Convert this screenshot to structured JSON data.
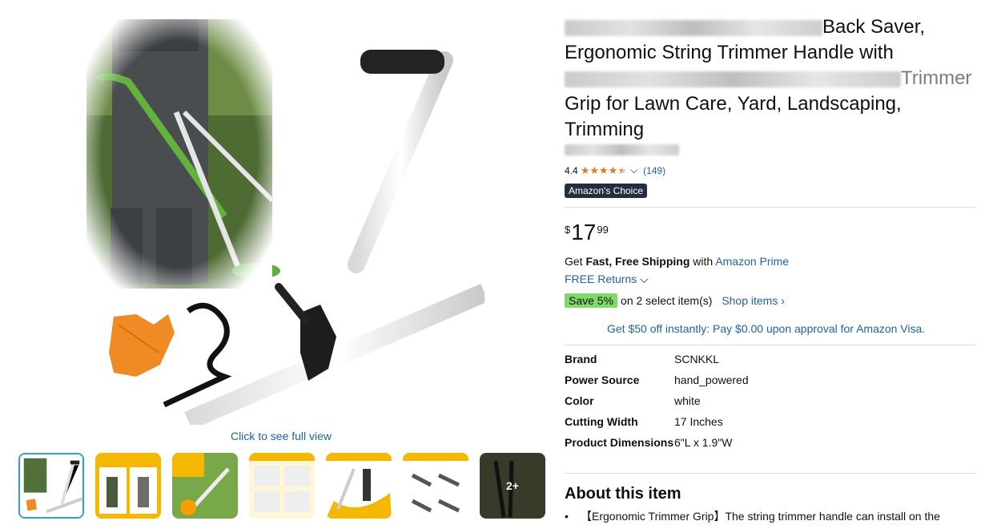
{
  "product": {
    "title_line1": "Back Saver,",
    "title_line2": "Ergonomic String Trimmer Handle with",
    "title_line3_suffix": "Trimmer",
    "title_line4": "Grip for Lawn Care, Yard, Landscaping,",
    "title_line5": "Trimming"
  },
  "gallery": {
    "click_full_view": "Click to see full view",
    "more_label": "2+"
  },
  "rating": {
    "value": "4.4",
    "stars": 4.4,
    "count": "(149)"
  },
  "badge": {
    "choice": "Amazon's Choice"
  },
  "price": {
    "symbol": "$",
    "whole": "17",
    "fraction": "99"
  },
  "shipping": {
    "prefix": "Get ",
    "bold": "Fast, Free Shipping",
    "middle": " with ",
    "prime": "Amazon Prime"
  },
  "returns": {
    "label": "FREE Returns"
  },
  "promo": {
    "save_badge": "Save 5%",
    "text": "on 2 select item(s)",
    "shop_link": "Shop items ›"
  },
  "visa_offer": "Get $50 off instantly: Pay $0.00 upon approval for Amazon Visa.",
  "specs": [
    {
      "key": "Brand",
      "value": "SCNKKL"
    },
    {
      "key": "Power Source",
      "value": "hand_powered"
    },
    {
      "key": "Color",
      "value": "white"
    },
    {
      "key": "Cutting Width",
      "value": "17 Inches"
    },
    {
      "key": "Product Dimensions",
      "value": "6\"L x 1.9\"W"
    }
  ],
  "about": {
    "title": "About this item",
    "bullet1": "【Ergonomic Trimmer Grip】The string trimmer handle can install on the"
  },
  "colors": {
    "link": "#2162a1",
    "star": "#de7921",
    "badge_bg": "#232f3e",
    "save_bg": "#7fda69"
  }
}
